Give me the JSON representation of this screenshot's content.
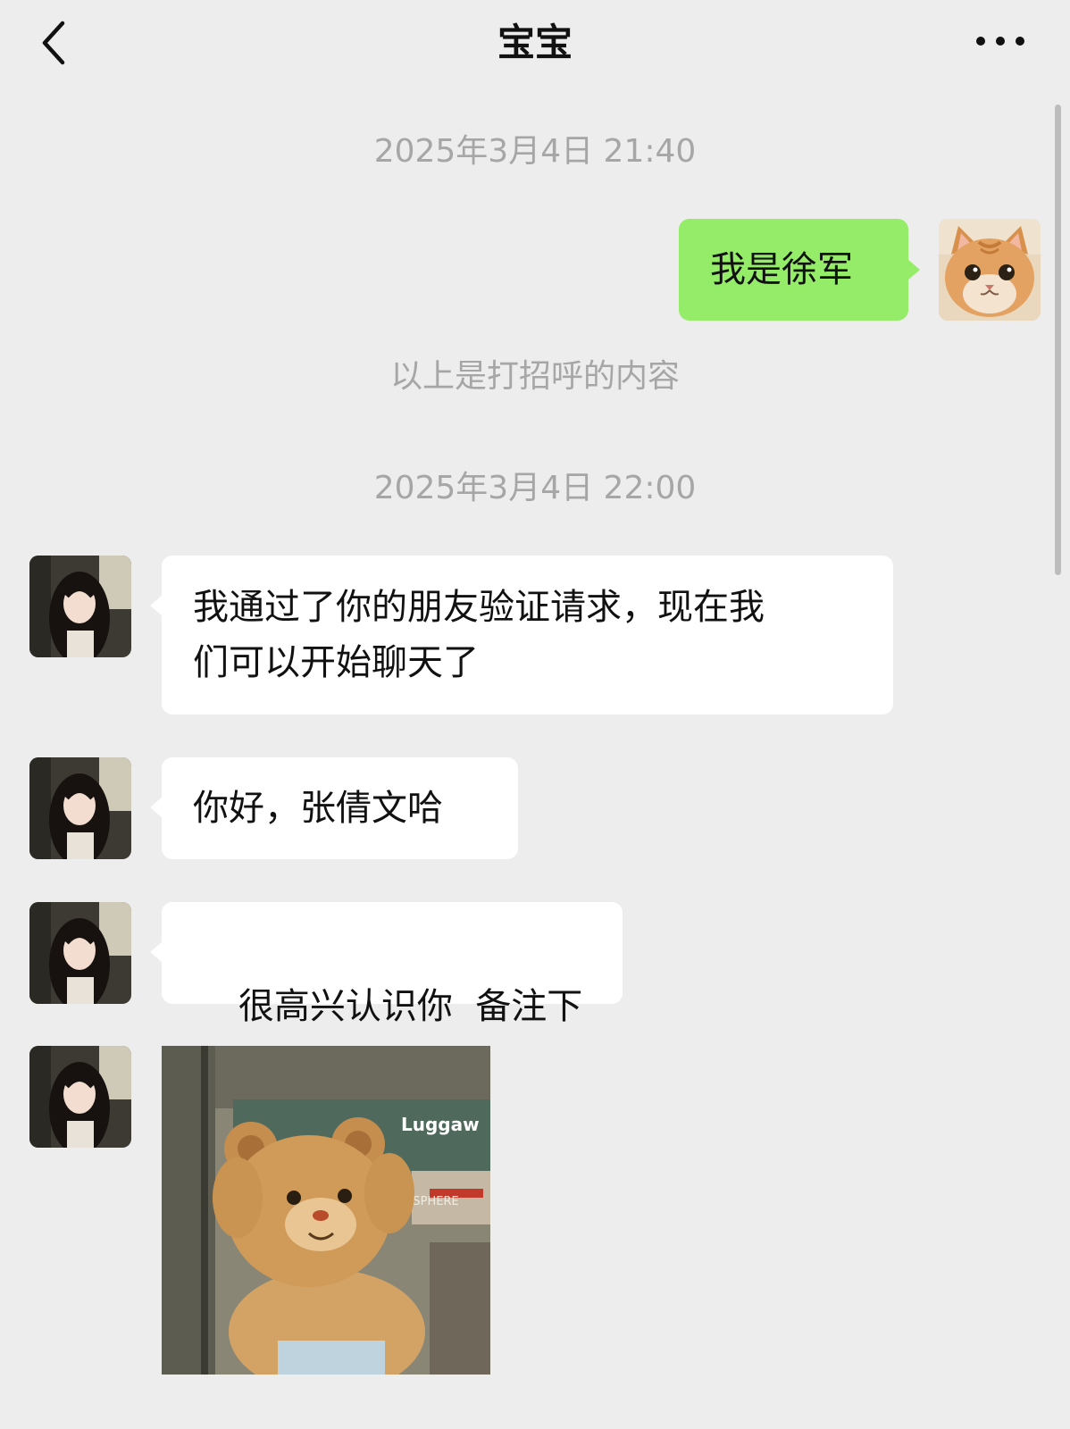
{
  "header": {
    "title": "宝宝",
    "back_icon": "chevron-left-icon",
    "more_icon": "more-dots-icon"
  },
  "colors": {
    "background": "#ededed",
    "my_bubble": "#95ec69",
    "their_bubble": "#ffffff",
    "system_text": "#a6a6a6"
  },
  "messages": {
    "time1": "2025年3月4日 21:40",
    "my_msg": "我是徐军",
    "greeting_note": "以上是打招呼的内容",
    "time2": "2025年3月4日 22:00",
    "msg1_line1": "我通过了你的朋友验证请求，现在我",
    "msg1_line2": "们可以开始聊天了",
    "msg2": "你好，张倩文哈",
    "msg3": "很高兴认识你  备注下",
    "sticker_text": "Luggaw",
    "sticker_sign": "EMSPHERE"
  }
}
